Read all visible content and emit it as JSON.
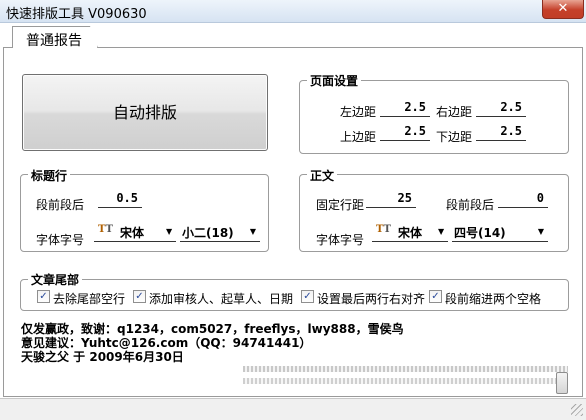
{
  "window": {
    "title": "快速排版工具 V090630",
    "close_glyph": "✕"
  },
  "tab": {
    "label": "普通报告"
  },
  "main_button": {
    "label": "自动排版"
  },
  "page_setup": {
    "legend": "页面设置",
    "left_margin": {
      "label": "左边距",
      "value": "2.5"
    },
    "right_margin": {
      "label": "右边距",
      "value": "2.5"
    },
    "top_margin": {
      "label": "上边距",
      "value": "2.5"
    },
    "bottom_margin": {
      "label": "下边距",
      "value": "2.5"
    }
  },
  "title_line": {
    "legend": "标题行",
    "space_before_after": {
      "label": "段前段后",
      "value": "0.5"
    },
    "font_label": "字体字号",
    "font_name": "宋体",
    "font_size": "小二(18)"
  },
  "body_text": {
    "legend": "正文",
    "fixed_line_spacing": {
      "label": "固定行距",
      "value": "25"
    },
    "space_before_after": {
      "label": "段前段后",
      "value": "0"
    },
    "font_label": "字体字号",
    "font_name": "宋体",
    "font_size": "四号(14)"
  },
  "article_tail": {
    "legend": "文章尾部",
    "options": [
      {
        "label": "去除尾部空行",
        "checked": true
      },
      {
        "label": "添加审核人、起草人、日期",
        "checked": true
      },
      {
        "label": "设置最后两行右对齐",
        "checked": true
      },
      {
        "label": "段前缩进两个空格",
        "checked": true
      }
    ]
  },
  "info": {
    "line1": "仅发赢政，致谢：q1234，com5027，freeflys，lwy888，雪侯鸟",
    "line2": "意见建议：Yuhtc@126.com（QQ：94741441）",
    "line3": "天骏之父 于 2009年6月30日"
  },
  "icons": {
    "font_type_icon": "truetype-icon",
    "dropdown_arrow": "▼",
    "check_mark": "✓"
  },
  "colors": {
    "titlebar_bg": "#d6e3f2",
    "close_button": "#c5402a",
    "check_color": "#2a4a9a"
  }
}
